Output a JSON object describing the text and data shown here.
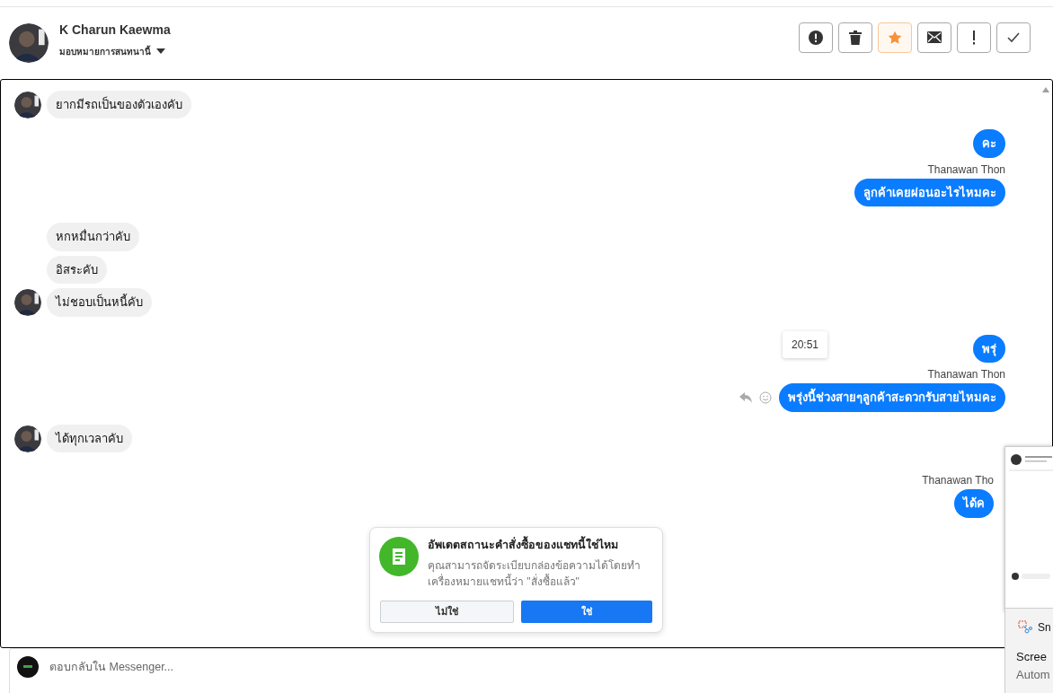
{
  "header": {
    "name": "K Charun Kaewma",
    "assign": "มอบหมายการสนทนานี้",
    "actions": [
      {
        "kind": "alert",
        "active": false
      },
      {
        "kind": "trash",
        "active": false
      },
      {
        "kind": "star",
        "active": true
      },
      {
        "kind": "mail",
        "active": false
      },
      {
        "kind": "bang",
        "active": false
      },
      {
        "kind": "check",
        "active": false
      }
    ]
  },
  "messages": [
    {
      "kind": "in",
      "text": "ยากมีรถเป็นของตัวเองคับ",
      "avatar": true
    },
    {
      "kind": "out",
      "text": "คะ",
      "hover": false,
      "clipped": false
    },
    {
      "kind": "out",
      "sender": "Thanawan Thon",
      "text": "ลูกค้าเคยผ่อนอะไรไหมคะ",
      "hover": false,
      "clipped": false
    },
    {
      "kind": "in",
      "text": "หกหมื่นกว่าคับ",
      "avatar": false
    },
    {
      "kind": "in",
      "text": "อิสระคับ",
      "avatar": false
    },
    {
      "kind": "in",
      "text": "ไม่ชอบเป็นหนี้คับ",
      "avatar": true
    },
    {
      "kind": "out",
      "text": "พรุ่",
      "hover": false,
      "clipped": false
    },
    {
      "kind": "out",
      "sender": "Thanawan Thon",
      "text": "พรุ่งนี้ช่วงสายๆลูกค้าสะดวกรับสายไหมคะ",
      "time": "20:51",
      "hover": true,
      "clipped": false
    },
    {
      "kind": "in",
      "text": "ได้ทุกเวลาคับ",
      "avatar": true
    },
    {
      "kind": "out",
      "sender": "Thanawan Tho",
      "text": "ได้ค",
      "hover": false,
      "clipped": true
    }
  ],
  "prompt": {
    "title": "อัพเดตสถานะคำสั่งซื้อของแชทนี้ใช่ไหม",
    "body": "คุณสามารถจัดระเบียบกล่องข้อความได้โดยทำเครื่องหมายแชทนี้ว่า \"สั่งซื้อแล้ว\"",
    "no": "ไม่ใช่",
    "yes": "ใช่"
  },
  "composer": {
    "placeholder": "ตอบกลับใน Messenger..."
  },
  "snip": {
    "app": "Sn",
    "line1": "Scree",
    "line2": "Autom"
  }
}
